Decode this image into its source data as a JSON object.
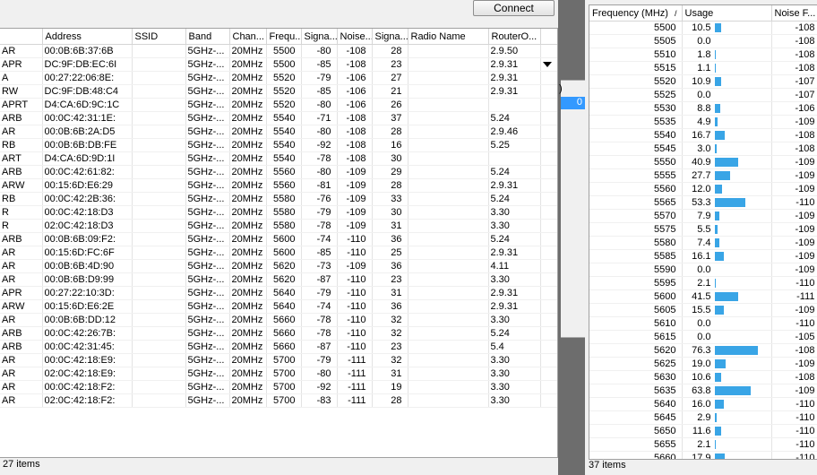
{
  "left": {
    "connect_label": "Connect",
    "columns": [
      "",
      "Address",
      "SSID",
      "Band",
      "Chan...",
      "Frequ...",
      "Signa...",
      "Noise...",
      "Signa...",
      "Radio Name",
      "RouterO..."
    ],
    "rows": [
      [
        "AR",
        "00:0B:6B:37:6B",
        "",
        "5GHz-...",
        "20MHz",
        "5500",
        "-80",
        "-108",
        "28",
        "",
        "2.9.50"
      ],
      [
        "APR",
        "DC:9F:DB:EC:6I",
        "",
        "5GHz-...",
        "20MHz",
        "5500",
        "-85",
        "-108",
        "23",
        "",
        "2.9.31"
      ],
      [
        "A",
        "00:27:22:06:8E:",
        "",
        "5GHz-...",
        "20MHz",
        "5520",
        "-79",
        "-106",
        "27",
        "",
        "2.9.31"
      ],
      [
        "RW",
        "DC:9F:DB:48:C4",
        "",
        "5GHz-...",
        "20MHz",
        "5520",
        "-85",
        "-106",
        "21",
        "",
        "2.9.31"
      ],
      [
        "APRT",
        "D4:CA:6D:9C:1C",
        "",
        "5GHz-...",
        "20MHz",
        "5520",
        "-80",
        "-106",
        "26",
        "",
        ""
      ],
      [
        "ARB",
        "00:0C:42:31:1E:",
        "",
        "5GHz-...",
        "20MHz",
        "5540",
        "-71",
        "-108",
        "37",
        "",
        "5.24"
      ],
      [
        "AR",
        "00:0B:6B:2A:D5",
        "",
        "5GHz-...",
        "20MHz",
        "5540",
        "-80",
        "-108",
        "28",
        "",
        "2.9.46"
      ],
      [
        "RB",
        "00:0B:6B:DB:FE",
        "",
        "5GHz-...",
        "20MHz",
        "5540",
        "-92",
        "-108",
        "16",
        "",
        "5.25"
      ],
      [
        "ART",
        "D4:CA:6D:9D:1I",
        "",
        "5GHz-...",
        "20MHz",
        "5540",
        "-78",
        "-108",
        "30",
        "",
        ""
      ],
      [
        "ARB",
        "00:0C:42:61:82:",
        "",
        "5GHz-...",
        "20MHz",
        "5560",
        "-80",
        "-109",
        "29",
        "",
        "5.24"
      ],
      [
        "ARW",
        "00:15:6D:E6:29",
        "",
        "5GHz-...",
        "20MHz",
        "5560",
        "-81",
        "-109",
        "28",
        "",
        "2.9.31"
      ],
      [
        "RB",
        "00:0C:42:2B:36:",
        "",
        "5GHz-...",
        "20MHz",
        "5580",
        "-76",
        "-109",
        "33",
        "",
        "5.24"
      ],
      [
        "R",
        "00:0C:42:18:D3",
        "",
        "5GHz-...",
        "20MHz",
        "5580",
        "-79",
        "-109",
        "30",
        "",
        "3.30"
      ],
      [
        "R",
        "02:0C:42:18:D3",
        "",
        "5GHz-...",
        "20MHz",
        "5580",
        "-78",
        "-109",
        "31",
        "",
        "3.30"
      ],
      [
        "ARB",
        "00:0B:6B:09:F2:",
        "",
        "5GHz-...",
        "20MHz",
        "5600",
        "-74",
        "-110",
        "36",
        "",
        "5.24"
      ],
      [
        "AR",
        "00:15:6D:FC:6F",
        "",
        "5GHz-...",
        "20MHz",
        "5600",
        "-85",
        "-110",
        "25",
        "",
        "2.9.31"
      ],
      [
        "AR",
        "00:0B:6B:4D:90",
        "",
        "5GHz-...",
        "20MHz",
        "5620",
        "-73",
        "-109",
        "36",
        "",
        "4.11"
      ],
      [
        "AR",
        "00:0B:6B:D9:99",
        "",
        "5GHz-...",
        "20MHz",
        "5620",
        "-87",
        "-110",
        "23",
        "",
        "3.30"
      ],
      [
        "APR",
        "00:27:22:10:3D:",
        "",
        "5GHz-...",
        "20MHz",
        "5640",
        "-79",
        "-110",
        "31",
        "",
        "2.9.31"
      ],
      [
        "ARW",
        "00:15:6D:E6:2E",
        "",
        "5GHz-...",
        "20MHz",
        "5640",
        "-74",
        "-110",
        "36",
        "",
        "2.9.31"
      ],
      [
        "AR",
        "00:0B:6B:DD:12",
        "",
        "5GHz-...",
        "20MHz",
        "5660",
        "-78",
        "-110",
        "32",
        "",
        "3.30"
      ],
      [
        "ARB",
        "00:0C:42:26:7B:",
        "",
        "5GHz-...",
        "20MHz",
        "5660",
        "-78",
        "-110",
        "32",
        "",
        "5.24"
      ],
      [
        "ARB",
        "00:0C:42:31:45:",
        "",
        "5GHz-...",
        "20MHz",
        "5660",
        "-87",
        "-110",
        "23",
        "",
        "5.4"
      ],
      [
        "AR",
        "00:0C:42:18:E9:",
        "",
        "5GHz-...",
        "20MHz",
        "5700",
        "-79",
        "-111",
        "32",
        "",
        "3.30"
      ],
      [
        "AR",
        "02:0C:42:18:E9:",
        "",
        "5GHz-...",
        "20MHz",
        "5700",
        "-80",
        "-111",
        "31",
        "",
        "3.30"
      ],
      [
        "AR",
        "00:0C:42:18:F2:",
        "",
        "5GHz-...",
        "20MHz",
        "5700",
        "-92",
        "-111",
        "19",
        "",
        "3.30"
      ],
      [
        "AR",
        "02:0C:42:18:F2:",
        "",
        "5GHz-...",
        "20MHz",
        "5700",
        "-83",
        "-111",
        "28",
        "",
        "3.30"
      ]
    ],
    "status": "27 items"
  },
  "middle": {
    "paren": ")",
    "selected": "0"
  },
  "right": {
    "columns": [
      "Frequency (MHz)",
      "/",
      "Usage",
      "Noise F..."
    ],
    "rows": [
      [
        "5500",
        "10.5",
        "-108"
      ],
      [
        "5505",
        "0.0",
        "-108"
      ],
      [
        "5510",
        "1.8",
        "-108"
      ],
      [
        "5515",
        "1.1",
        "-108"
      ],
      [
        "5520",
        "10.9",
        "-107"
      ],
      [
        "5525",
        "0.0",
        "-107"
      ],
      [
        "5530",
        "8.8",
        "-106"
      ],
      [
        "5535",
        "4.9",
        "-109"
      ],
      [
        "5540",
        "16.7",
        "-108"
      ],
      [
        "5545",
        "3.0",
        "-108"
      ],
      [
        "5550",
        "40.9",
        "-109"
      ],
      [
        "5555",
        "27.7",
        "-109"
      ],
      [
        "5560",
        "12.0",
        "-109"
      ],
      [
        "5565",
        "53.3",
        "-110"
      ],
      [
        "5570",
        "7.9",
        "-109"
      ],
      [
        "5575",
        "5.5",
        "-109"
      ],
      [
        "5580",
        "7.4",
        "-109"
      ],
      [
        "5585",
        "16.1",
        "-109"
      ],
      [
        "5590",
        "0.0",
        "-109"
      ],
      [
        "5595",
        "2.1",
        "-110"
      ],
      [
        "5600",
        "41.5",
        "-111"
      ],
      [
        "5605",
        "15.5",
        "-109"
      ],
      [
        "5610",
        "0.0",
        "-110"
      ],
      [
        "5615",
        "0.0",
        "-105"
      ],
      [
        "5620",
        "76.3",
        "-108"
      ],
      [
        "5625",
        "19.0",
        "-109"
      ],
      [
        "5630",
        "10.6",
        "-108"
      ],
      [
        "5635",
        "63.8",
        "-109"
      ],
      [
        "5640",
        "16.0",
        "-110"
      ],
      [
        "5645",
        "2.9",
        "-110"
      ],
      [
        "5650",
        "11.6",
        "-110"
      ],
      [
        "5655",
        "2.1",
        "-110"
      ],
      [
        "5660",
        "17.9",
        "-110"
      ]
    ],
    "status": "37 items",
    "bar_color": "#39a5e6"
  }
}
